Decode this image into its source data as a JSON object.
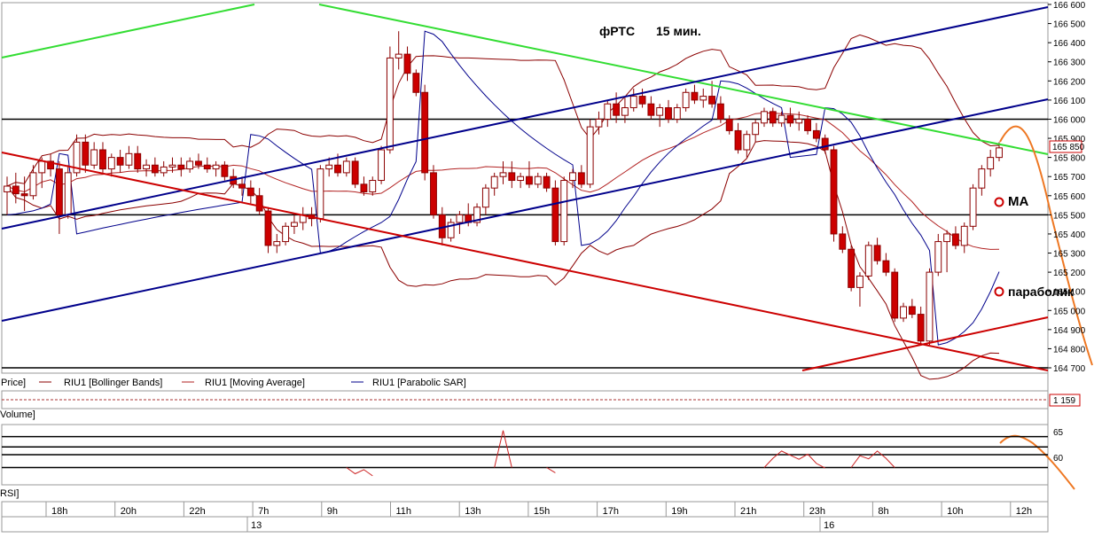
{
  "chart_data": {
    "type": "candlestick",
    "title": "фРТС",
    "timeframe": "15 мин.",
    "price_axis": {
      "ylim": [
        164700,
        166600
      ],
      "ticks": [
        164700,
        164800,
        164900,
        165000,
        165100,
        165200,
        165300,
        165400,
        165500,
        165600,
        165700,
        165800,
        165900,
        166000,
        166100,
        166200,
        166300,
        166400,
        166500,
        166600
      ],
      "tick_labels": [
        "164 700",
        "164 800",
        "164 900",
        "165 000",
        "165 100",
        "165 200",
        "165 300",
        "165 400",
        "165 500",
        "165 600",
        "165 700",
        "165 800",
        "165 900",
        "166 000",
        "166 100",
        "166 200",
        "166 300",
        "166 400",
        "166 500",
        "166 600"
      ],
      "last_price": 165850,
      "last_price_label": "165 850"
    },
    "horizontal_levels": [
      166000,
      165500,
      164700
    ],
    "legend": {
      "price_label": "Price]",
      "entries": [
        {
          "name": "RIU1 [Bollinger Bands]",
          "color": "#8b0000"
        },
        {
          "name": "RIU1 [Moving Average]",
          "color": "#b22222"
        },
        {
          "name": "RIU1 [Parabolic SAR]",
          "color": "#00008b"
        }
      ]
    },
    "annotations": [
      {
        "text": "MA",
        "color": "#cc0000"
      },
      {
        "text": "параболик",
        "color": "#cc0000"
      }
    ],
    "candles": [
      {
        "o": 165620,
        "h": 165700,
        "l": 165500,
        "c": 165650
      },
      {
        "o": 165650,
        "h": 165720,
        "l": 165560,
        "c": 165610
      },
      {
        "o": 165610,
        "h": 165700,
        "l": 165520,
        "c": 165600
      },
      {
        "o": 165600,
        "h": 165760,
        "l": 165580,
        "c": 165720
      },
      {
        "o": 165720,
        "h": 165800,
        "l": 165640,
        "c": 165780
      },
      {
        "o": 165780,
        "h": 165820,
        "l": 165700,
        "c": 165740
      },
      {
        "o": 165740,
        "h": 165780,
        "l": 165400,
        "c": 165500
      },
      {
        "o": 165500,
        "h": 165760,
        "l": 165480,
        "c": 165720
      },
      {
        "o": 165720,
        "h": 165920,
        "l": 165700,
        "c": 165880
      },
      {
        "o": 165880,
        "h": 165920,
        "l": 165720,
        "c": 165760
      },
      {
        "o": 165760,
        "h": 165880,
        "l": 165740,
        "c": 165840
      },
      {
        "o": 165840,
        "h": 165880,
        "l": 165720,
        "c": 165740
      },
      {
        "o": 165740,
        "h": 165820,
        "l": 165700,
        "c": 165800
      },
      {
        "o": 165800,
        "h": 165840,
        "l": 165720,
        "c": 165760
      },
      {
        "o": 165760,
        "h": 165860,
        "l": 165740,
        "c": 165820
      },
      {
        "o": 165820,
        "h": 165860,
        "l": 165720,
        "c": 165740
      },
      {
        "o": 165740,
        "h": 165790,
        "l": 165700,
        "c": 165760
      },
      {
        "o": 165760,
        "h": 165800,
        "l": 165700,
        "c": 165720
      },
      {
        "o": 165720,
        "h": 165780,
        "l": 165700,
        "c": 165750
      },
      {
        "o": 165750,
        "h": 165800,
        "l": 165720,
        "c": 165760
      },
      {
        "o": 165760,
        "h": 165800,
        "l": 165700,
        "c": 165740
      },
      {
        "o": 165740,
        "h": 165800,
        "l": 165720,
        "c": 165780
      },
      {
        "o": 165780,
        "h": 165820,
        "l": 165740,
        "c": 165760
      },
      {
        "o": 165760,
        "h": 165800,
        "l": 165720,
        "c": 165740
      },
      {
        "o": 165740,
        "h": 165780,
        "l": 165700,
        "c": 165760
      },
      {
        "o": 165760,
        "h": 165780,
        "l": 165680,
        "c": 165700
      },
      {
        "o": 165700,
        "h": 165740,
        "l": 165640,
        "c": 165660
      },
      {
        "o": 165660,
        "h": 165700,
        "l": 165600,
        "c": 165640
      },
      {
        "o": 165640,
        "h": 165680,
        "l": 165560,
        "c": 165600
      },
      {
        "o": 165600,
        "h": 165640,
        "l": 165500,
        "c": 165520
      },
      {
        "o": 165520,
        "h": 165540,
        "l": 165300,
        "c": 165340
      },
      {
        "o": 165340,
        "h": 165400,
        "l": 165300,
        "c": 165360
      },
      {
        "o": 165360,
        "h": 165460,
        "l": 165340,
        "c": 165440
      },
      {
        "o": 165440,
        "h": 165500,
        "l": 165400,
        "c": 165460
      },
      {
        "o": 165460,
        "h": 165540,
        "l": 165420,
        "c": 165500
      },
      {
        "o": 165500,
        "h": 165540,
        "l": 165440,
        "c": 165480
      },
      {
        "o": 165480,
        "h": 165760,
        "l": 165460,
        "c": 165740
      },
      {
        "o": 165740,
        "h": 165800,
        "l": 165700,
        "c": 165760
      },
      {
        "o": 165760,
        "h": 165820,
        "l": 165700,
        "c": 165720
      },
      {
        "o": 165720,
        "h": 165800,
        "l": 165700,
        "c": 165780
      },
      {
        "o": 165780,
        "h": 165800,
        "l": 165640,
        "c": 165660
      },
      {
        "o": 165660,
        "h": 165700,
        "l": 165600,
        "c": 165620
      },
      {
        "o": 165620,
        "h": 165700,
        "l": 165600,
        "c": 165680
      },
      {
        "o": 165680,
        "h": 165860,
        "l": 165660,
        "c": 165840
      },
      {
        "o": 165840,
        "h": 166380,
        "l": 165820,
        "c": 166320
      },
      {
        "o": 166320,
        "h": 166460,
        "l": 166260,
        "c": 166340
      },
      {
        "o": 166340,
        "h": 166380,
        "l": 166200,
        "c": 166240
      },
      {
        "o": 166240,
        "h": 166260,
        "l": 166120,
        "c": 166140
      },
      {
        "o": 166140,
        "h": 166180,
        "l": 165680,
        "c": 165720
      },
      {
        "o": 165720,
        "h": 165760,
        "l": 165480,
        "c": 165500
      },
      {
        "o": 165500,
        "h": 165540,
        "l": 165340,
        "c": 165380
      },
      {
        "o": 165380,
        "h": 165480,
        "l": 165360,
        "c": 165460
      },
      {
        "o": 165460,
        "h": 165520,
        "l": 165400,
        "c": 165500
      },
      {
        "o": 165500,
        "h": 165560,
        "l": 165440,
        "c": 165460
      },
      {
        "o": 165460,
        "h": 165560,
        "l": 165440,
        "c": 165540
      },
      {
        "o": 165540,
        "h": 165660,
        "l": 165500,
        "c": 165640
      },
      {
        "o": 165640,
        "h": 165720,
        "l": 165600,
        "c": 165700
      },
      {
        "o": 165700,
        "h": 165780,
        "l": 165660,
        "c": 165720
      },
      {
        "o": 165720,
        "h": 165780,
        "l": 165640,
        "c": 165680
      },
      {
        "o": 165680,
        "h": 165720,
        "l": 165640,
        "c": 165700
      },
      {
        "o": 165700,
        "h": 165780,
        "l": 165640,
        "c": 165660
      },
      {
        "o": 165660,
        "h": 165720,
        "l": 165640,
        "c": 165700
      },
      {
        "o": 165700,
        "h": 165720,
        "l": 165620,
        "c": 165640
      },
      {
        "o": 165640,
        "h": 165680,
        "l": 165340,
        "c": 165360
      },
      {
        "o": 165360,
        "h": 165700,
        "l": 165340,
        "c": 165680
      },
      {
        "o": 165680,
        "h": 165740,
        "l": 165640,
        "c": 165720
      },
      {
        "o": 165720,
        "h": 165760,
        "l": 165640,
        "c": 165660
      },
      {
        "o": 165660,
        "h": 166000,
        "l": 165640,
        "c": 165960
      },
      {
        "o": 165960,
        "h": 166040,
        "l": 165920,
        "c": 166000
      },
      {
        "o": 166000,
        "h": 166100,
        "l": 165960,
        "c": 166080
      },
      {
        "o": 166080,
        "h": 166140,
        "l": 165980,
        "c": 166020
      },
      {
        "o": 166020,
        "h": 166120,
        "l": 165980,
        "c": 166060
      },
      {
        "o": 166060,
        "h": 166160,
        "l": 166040,
        "c": 166120
      },
      {
        "o": 166120,
        "h": 166160,
        "l": 166060,
        "c": 166080
      },
      {
        "o": 166080,
        "h": 166120,
        "l": 166000,
        "c": 166020
      },
      {
        "o": 166020,
        "h": 166080,
        "l": 165960,
        "c": 166060
      },
      {
        "o": 166060,
        "h": 166100,
        "l": 165980,
        "c": 166000
      },
      {
        "o": 166000,
        "h": 166080,
        "l": 165980,
        "c": 166060
      },
      {
        "o": 166060,
        "h": 166160,
        "l": 166040,
        "c": 166140
      },
      {
        "o": 166140,
        "h": 166180,
        "l": 166080,
        "c": 166100
      },
      {
        "o": 166100,
        "h": 166160,
        "l": 166060,
        "c": 166120
      },
      {
        "o": 166120,
        "h": 166200,
        "l": 166060,
        "c": 166080
      },
      {
        "o": 166080,
        "h": 166120,
        "l": 165980,
        "c": 166000
      },
      {
        "o": 166000,
        "h": 166020,
        "l": 165920,
        "c": 165940
      },
      {
        "o": 165940,
        "h": 165980,
        "l": 165820,
        "c": 165840
      },
      {
        "o": 165840,
        "h": 165940,
        "l": 165800,
        "c": 165920
      },
      {
        "o": 165920,
        "h": 166000,
        "l": 165880,
        "c": 165980
      },
      {
        "o": 165980,
        "h": 166060,
        "l": 165960,
        "c": 166040
      },
      {
        "o": 166040,
        "h": 166060,
        "l": 165960,
        "c": 165980
      },
      {
        "o": 165980,
        "h": 166040,
        "l": 165960,
        "c": 166020
      },
      {
        "o": 166020,
        "h": 166060,
        "l": 165960,
        "c": 165980
      },
      {
        "o": 165980,
        "h": 166040,
        "l": 165940,
        "c": 166000
      },
      {
        "o": 166000,
        "h": 166020,
        "l": 165920,
        "c": 165940
      },
      {
        "o": 165940,
        "h": 165980,
        "l": 165880,
        "c": 165900
      },
      {
        "o": 165900,
        "h": 165920,
        "l": 165820,
        "c": 165840
      },
      {
        "o": 165840,
        "h": 165860,
        "l": 165360,
        "c": 165400
      },
      {
        "o": 165400,
        "h": 165440,
        "l": 165300,
        "c": 165320
      },
      {
        "o": 165320,
        "h": 165340,
        "l": 165100,
        "c": 165120
      },
      {
        "o": 165120,
        "h": 165200,
        "l": 165020,
        "c": 165180
      },
      {
        "o": 165180,
        "h": 165360,
        "l": 165160,
        "c": 165340
      },
      {
        "o": 165340,
        "h": 165380,
        "l": 165240,
        "c": 165260
      },
      {
        "o": 165260,
        "h": 165300,
        "l": 165180,
        "c": 165200
      },
      {
        "o": 165200,
        "h": 165220,
        "l": 164940,
        "c": 164960
      },
      {
        "o": 164960,
        "h": 165040,
        "l": 164940,
        "c": 165020
      },
      {
        "o": 165020,
        "h": 165060,
        "l": 164960,
        "c": 164980
      },
      {
        "o": 164980,
        "h": 165020,
        "l": 164820,
        "c": 164840
      },
      {
        "o": 164840,
        "h": 165220,
        "l": 164820,
        "c": 165200
      },
      {
        "o": 165200,
        "h": 165400,
        "l": 165180,
        "c": 165360
      },
      {
        "o": 165360,
        "h": 165420,
        "l": 165200,
        "c": 165400
      },
      {
        "o": 165400,
        "h": 165440,
        "l": 165320,
        "c": 165340
      },
      {
        "o": 165340,
        "h": 165460,
        "l": 165300,
        "c": 165440
      },
      {
        "o": 165440,
        "h": 165660,
        "l": 165420,
        "c": 165640
      },
      {
        "o": 165640,
        "h": 165760,
        "l": 165600,
        "c": 165740
      },
      {
        "o": 165740,
        "h": 165840,
        "l": 165700,
        "c": 165800
      },
      {
        "o": 165800,
        "h": 165880,
        "l": 165780,
        "c": 165850
      }
    ],
    "time_axis": {
      "hour_labels": [
        "18h",
        "20h",
        "22h",
        "7h",
        "9h",
        "11h",
        "13h",
        "15h",
        "17h",
        "19h",
        "21h",
        "23h",
        "8h",
        "10h",
        "12h"
      ],
      "date_labels": [
        "13",
        "16"
      ]
    },
    "panels": {
      "volume": {
        "label": "Volume]",
        "last_value": 1159,
        "last_value_label": "1 159"
      },
      "rsi": {
        "label": "RSI]",
        "ylim": [
          55,
          66
        ],
        "tick_labels": [
          "65",
          "60"
        ],
        "ticks": [
          65,
          60
        ],
        "levels": [
          64,
          62,
          60.5,
          58
        ],
        "visible_values": [
          [
            39,
            58
          ],
          [
            40,
            56.8
          ],
          [
            41,
            57.6
          ],
          [
            42,
            56.4
          ],
          [
            56,
            58
          ],
          [
            57,
            65.2
          ],
          [
            58,
            58
          ],
          [
            62,
            58
          ],
          [
            63,
            57
          ],
          [
            87,
            58
          ],
          [
            88,
            59.8
          ],
          [
            89,
            61.2
          ],
          [
            90,
            60.4
          ],
          [
            91,
            59.6
          ],
          [
            92,
            60.6
          ],
          [
            93,
            58.8
          ],
          [
            94,
            57.9
          ],
          [
            97,
            58
          ],
          [
            98,
            60.3
          ],
          [
            99,
            59.7
          ],
          [
            100,
            61.2
          ],
          [
            101,
            59.8
          ],
          [
            102,
            58
          ],
          [
            135,
            58
          ],
          [
            136,
            59
          ],
          [
            137,
            61
          ],
          [
            138,
            63
          ],
          [
            139,
            64
          ],
          [
            140,
            64.2
          ]
        ]
      }
    }
  }
}
